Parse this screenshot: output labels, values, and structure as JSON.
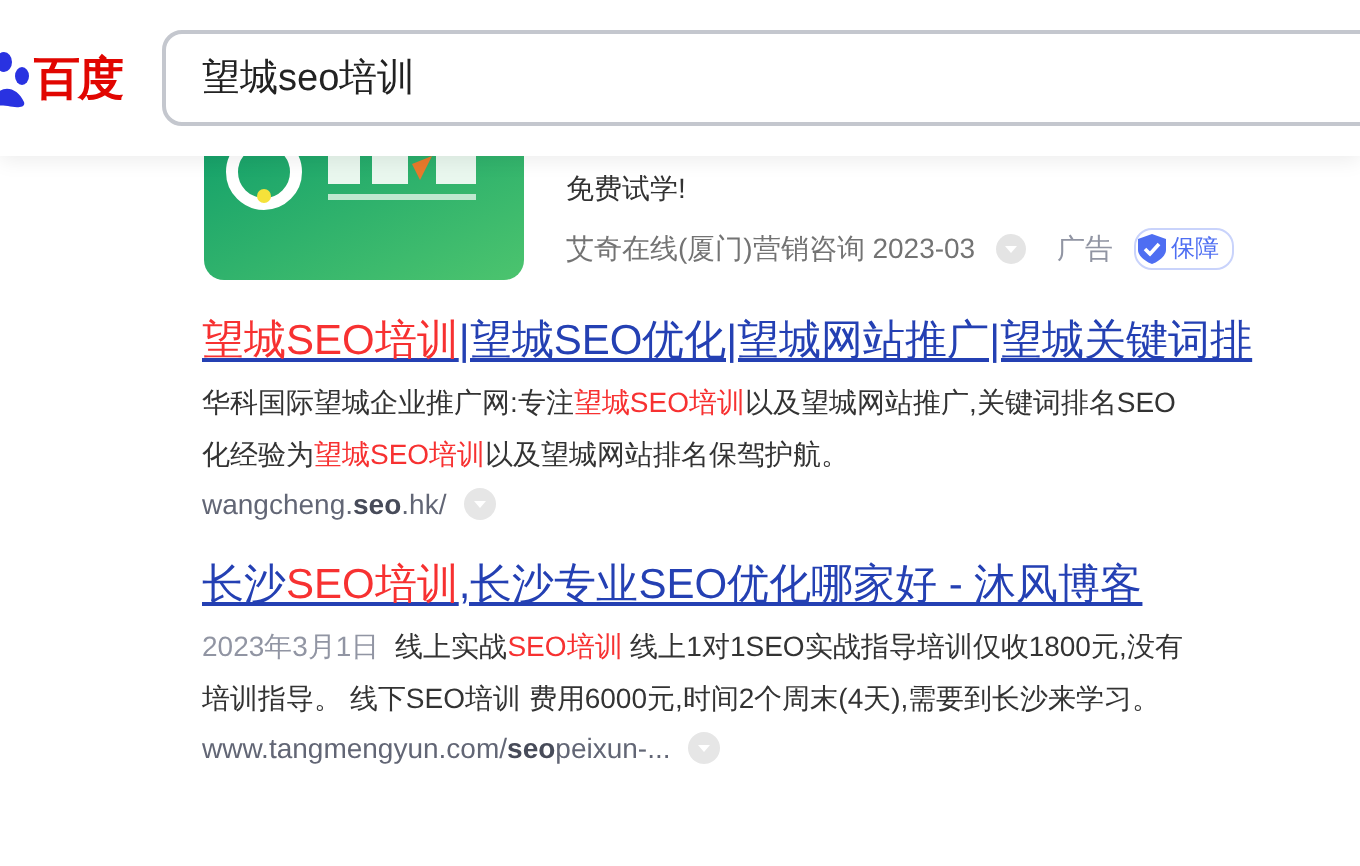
{
  "search": {
    "logo": "百度",
    "value": "望城seo培训"
  },
  "ad": {
    "tagline": "免费试学!",
    "source": "艾奇在线(厦门)营销咨询 2023-03",
    "label": "广告",
    "badge": "保障"
  },
  "results": [
    {
      "title": [
        {
          "text": "望城SEO培训",
          "em": true
        },
        {
          "text": "|望城SEO优化|望城网站推广|望城关键词排",
          "em": false
        }
      ],
      "lines": [
        [
          {
            "text": "华科国际望城企业推广网:专注",
            "em": false
          },
          {
            "text": "望城SEO培训",
            "em": true
          },
          {
            "text": "以及望城网站推广,关键词排名SEO",
            "em": false
          }
        ],
        [
          {
            "text": "化经验为",
            "em": false
          },
          {
            "text": "望城SEO培训",
            "em": true
          },
          {
            "text": "以及望城网站排名保驾护航。",
            "em": false
          }
        ]
      ],
      "url": "wangcheng.**seo**.hk/"
    },
    {
      "title": [
        {
          "text": "长沙",
          "em": false
        },
        {
          "text": "SEO培训",
          "em": true
        },
        {
          "text": ",长沙专业SEO优化哪家好 - 沐风博客",
          "em": false
        }
      ],
      "date": "2023年3月1日",
      "lines": [
        [
          {
            "text": "线上实战",
            "em": false
          },
          {
            "text": "SEO培训",
            "em": true
          },
          {
            "text": " 线上1对1SEO实战指导培训仅收1800元,没有",
            "em": false
          }
        ],
        [
          {
            "text": "培训指导。 线下SEO培训 费用6000元,时间2个周末(4天),需要到长沙来学习。",
            "em": false
          }
        ]
      ],
      "url": "www.tangmengyun.com/**seo**peixun-..."
    }
  ]
}
